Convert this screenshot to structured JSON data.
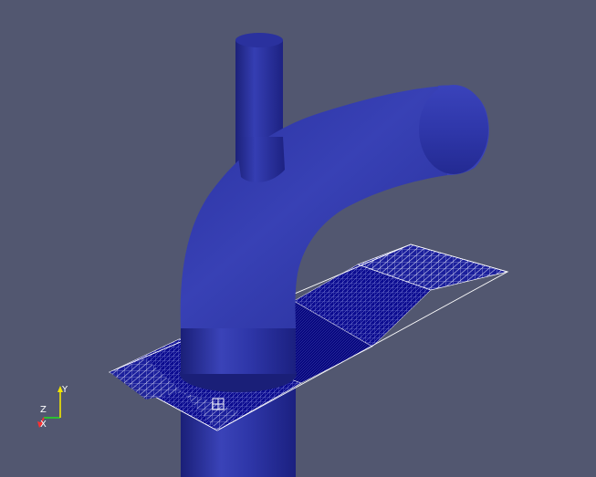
{
  "viewport": {
    "background": "#525770",
    "render_style": "surface",
    "surface_color": "#2b33a6",
    "mesh_color": "#ffffff"
  },
  "objects": [
    {
      "name": "pipe-assembly",
      "kind": "curved-pipe-with-branch",
      "color": "#2b33a6"
    },
    {
      "name": "mesh-slice",
      "kind": "wireframe-plane",
      "color": "#0a0a8f"
    }
  ],
  "orientation_axes": {
    "x": {
      "label": "X",
      "color": "#ff3030"
    },
    "y": {
      "label": "Y",
      "color": "#f2e600"
    },
    "z": {
      "label": "Z",
      "color": "#20e020"
    }
  }
}
